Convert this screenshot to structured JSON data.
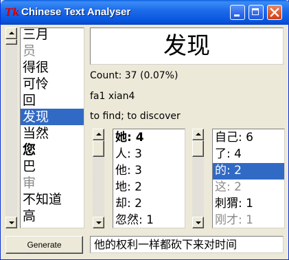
{
  "window": {
    "title": "Chinese Text Analyser",
    "icon": "tk-icon",
    "accent_color": "#316AC5"
  },
  "word_list": {
    "items": [
      {
        "text": "三月",
        "state": "normal"
      },
      {
        "text": "员",
        "state": "faded"
      },
      {
        "text": "得很",
        "state": "normal"
      },
      {
        "text": "可怜",
        "state": "normal"
      },
      {
        "text": "回",
        "state": "normal"
      },
      {
        "text": "发现",
        "state": "selected"
      },
      {
        "text": "当然",
        "state": "normal"
      },
      {
        "text": "您",
        "state": "bold"
      },
      {
        "text": "巴",
        "state": "normal"
      },
      {
        "text": "审",
        "state": "faded"
      },
      {
        "text": "不知道",
        "state": "normal"
      },
      {
        "text": "高",
        "state": "normal"
      }
    ]
  },
  "detail": {
    "word": "发现",
    "count": "Count:  37 (0.07%)",
    "pinyin": "fa1 xian4",
    "definition": "to find; to discover"
  },
  "preceding_list": {
    "items": [
      {
        "text": "她: 4",
        "state": "bold"
      },
      {
        "text": "人: 3",
        "state": "normal"
      },
      {
        "text": "他: 3",
        "state": "normal"
      },
      {
        "text": "地: 2",
        "state": "normal"
      },
      {
        "text": "却: 2",
        "state": "normal"
      },
      {
        "text": "忽然: 1",
        "state": "normal"
      }
    ]
  },
  "following_list": {
    "items": [
      {
        "text": "自己: 6",
        "state": "normal"
      },
      {
        "text": "了: 4",
        "state": "normal"
      },
      {
        "text": "的: 2",
        "state": "selected"
      },
      {
        "text": "这: 2",
        "state": "faded"
      },
      {
        "text": "刺猬: 1",
        "state": "normal"
      },
      {
        "text": "刚才: 1",
        "state": "faded"
      }
    ]
  },
  "footer": {
    "generate_label": "Generate",
    "sentence": "他的权利一样都砍下来对时间"
  }
}
